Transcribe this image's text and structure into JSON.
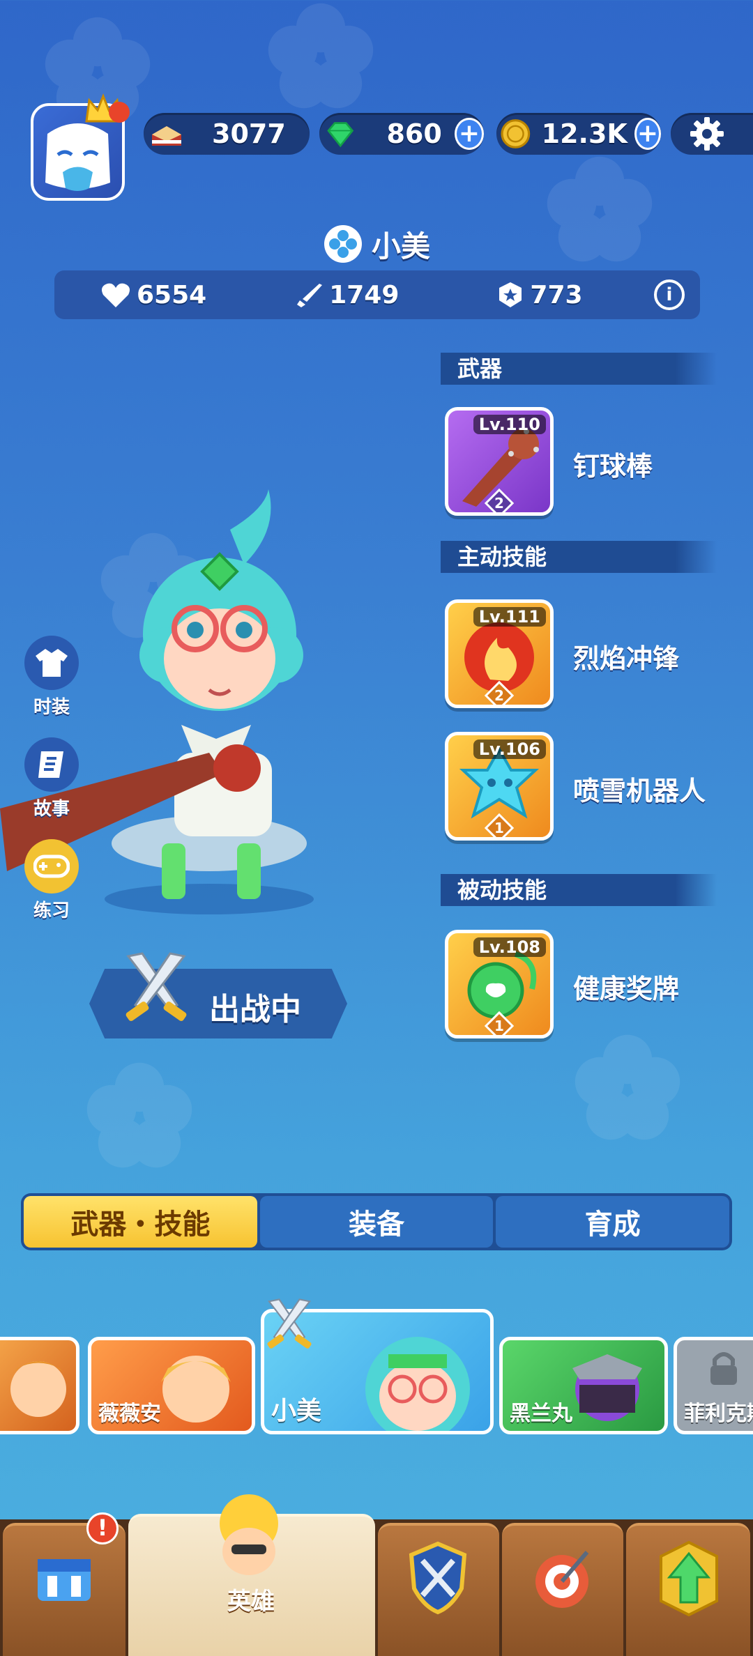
{
  "resources": {
    "cake": {
      "value": "3077",
      "icon": "cake-icon"
    },
    "gems": {
      "value": "860",
      "icon": "gem-icon"
    },
    "coins": {
      "value": "12.3K",
      "icon": "coin-icon"
    }
  },
  "hero": {
    "name": "小美",
    "stats": {
      "health": "6554",
      "attack": "1749",
      "power": "773"
    }
  },
  "sections": {
    "weapon": "武器",
    "active_skill": "主动技能",
    "passive_skill": "被动技能"
  },
  "skills": [
    {
      "name": "钉球棒",
      "level": "Lv.110",
      "star": "2",
      "color": "#9a4ad8"
    },
    {
      "name": "烈焰冲锋",
      "level": "Lv.111",
      "star": "2",
      "color": "#f0a020"
    },
    {
      "name": "喷雪机器人",
      "level": "Lv.106",
      "star": "1",
      "color": "#38c6e8"
    },
    {
      "name": "健康奖牌",
      "level": "Lv.108",
      "star": "1",
      "color": "#f2b41e"
    }
  ],
  "side_menu": [
    "时装",
    "故事",
    "练习"
  ],
  "deploy_label": "出战中",
  "tabs": [
    "武器・技能",
    "装备",
    "育成"
  ],
  "heroes": [
    "薇薇安",
    "小美",
    "黑兰丸",
    "菲利克斯"
  ],
  "nav": {
    "active_label": "英雄"
  }
}
